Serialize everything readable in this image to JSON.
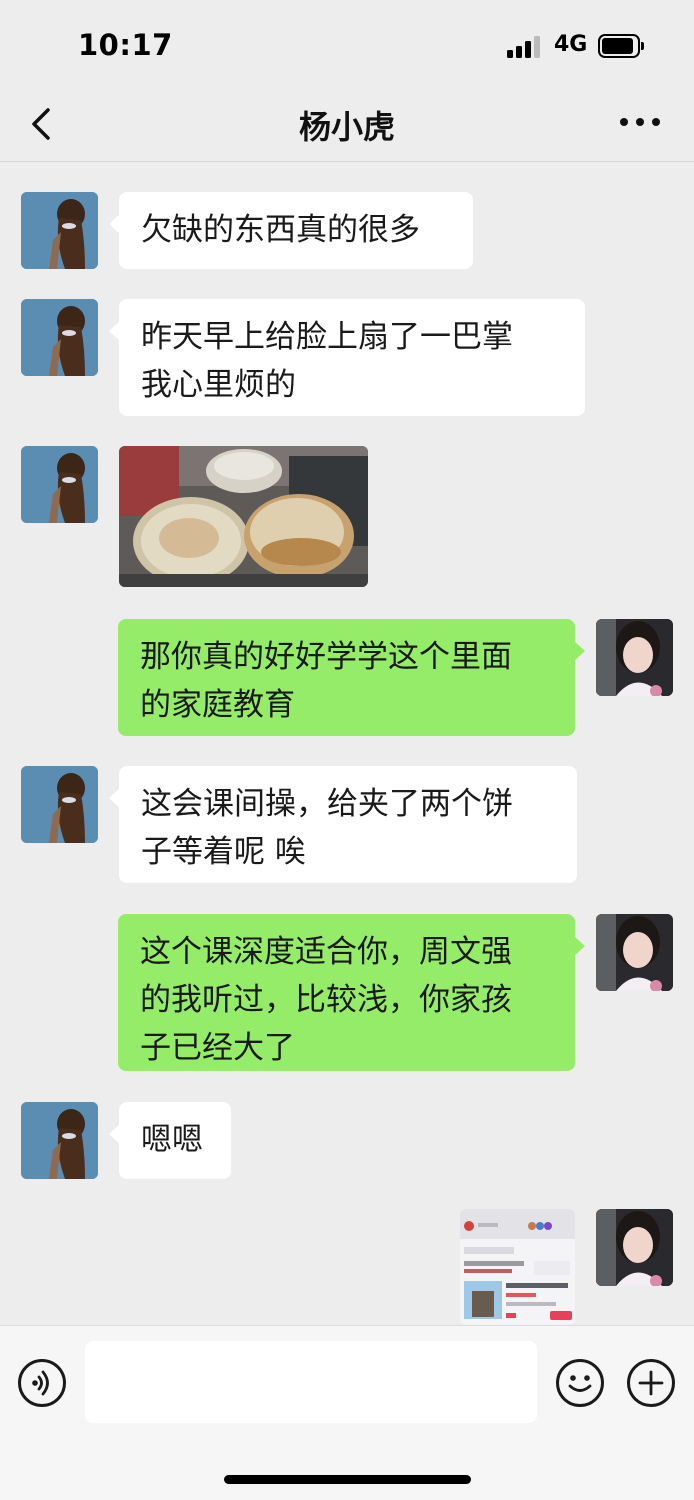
{
  "status_bar": {
    "time": "10:17",
    "network": "4G"
  },
  "header": {
    "title": "杨小虎",
    "back_icon": "chevron-left-icon",
    "more_icon": "more-dots-icon"
  },
  "messages": [
    {
      "side": "left",
      "type": "text",
      "lines": [
        "欠缺的东西真的很多"
      ]
    },
    {
      "side": "left",
      "type": "text",
      "lines": [
        "昨天早上给脸上扇了一巴掌",
        "我心里烦的"
      ]
    },
    {
      "side": "left",
      "type": "image",
      "description": "photo-of-two-flatbreads-in-plastic-bags"
    },
    {
      "side": "right",
      "type": "text",
      "lines": [
        "那你真的好好学学这个里面",
        "的家庭教育"
      ]
    },
    {
      "side": "left",
      "type": "text",
      "lines": [
        "这会课间操，给夹了两个饼",
        "子等着呢 唉"
      ]
    },
    {
      "side": "right",
      "type": "text",
      "lines": [
        "这个课深度适合你，周文强",
        "的我听过，比较浅，你家孩",
        "子已经大了"
      ]
    },
    {
      "side": "left",
      "type": "text",
      "lines": [
        "嗯嗯"
      ]
    },
    {
      "side": "right",
      "type": "image",
      "description": "screenshot-of-course-page"
    }
  ],
  "input_bar": {
    "voice_icon": "voice-icon",
    "emoji_icon": "emoji-icon",
    "plus_icon": "plus-icon",
    "input_value": ""
  },
  "colors": {
    "background": "#ededed",
    "bubble_self": "#95ec69",
    "bubble_other": "#ffffff"
  }
}
